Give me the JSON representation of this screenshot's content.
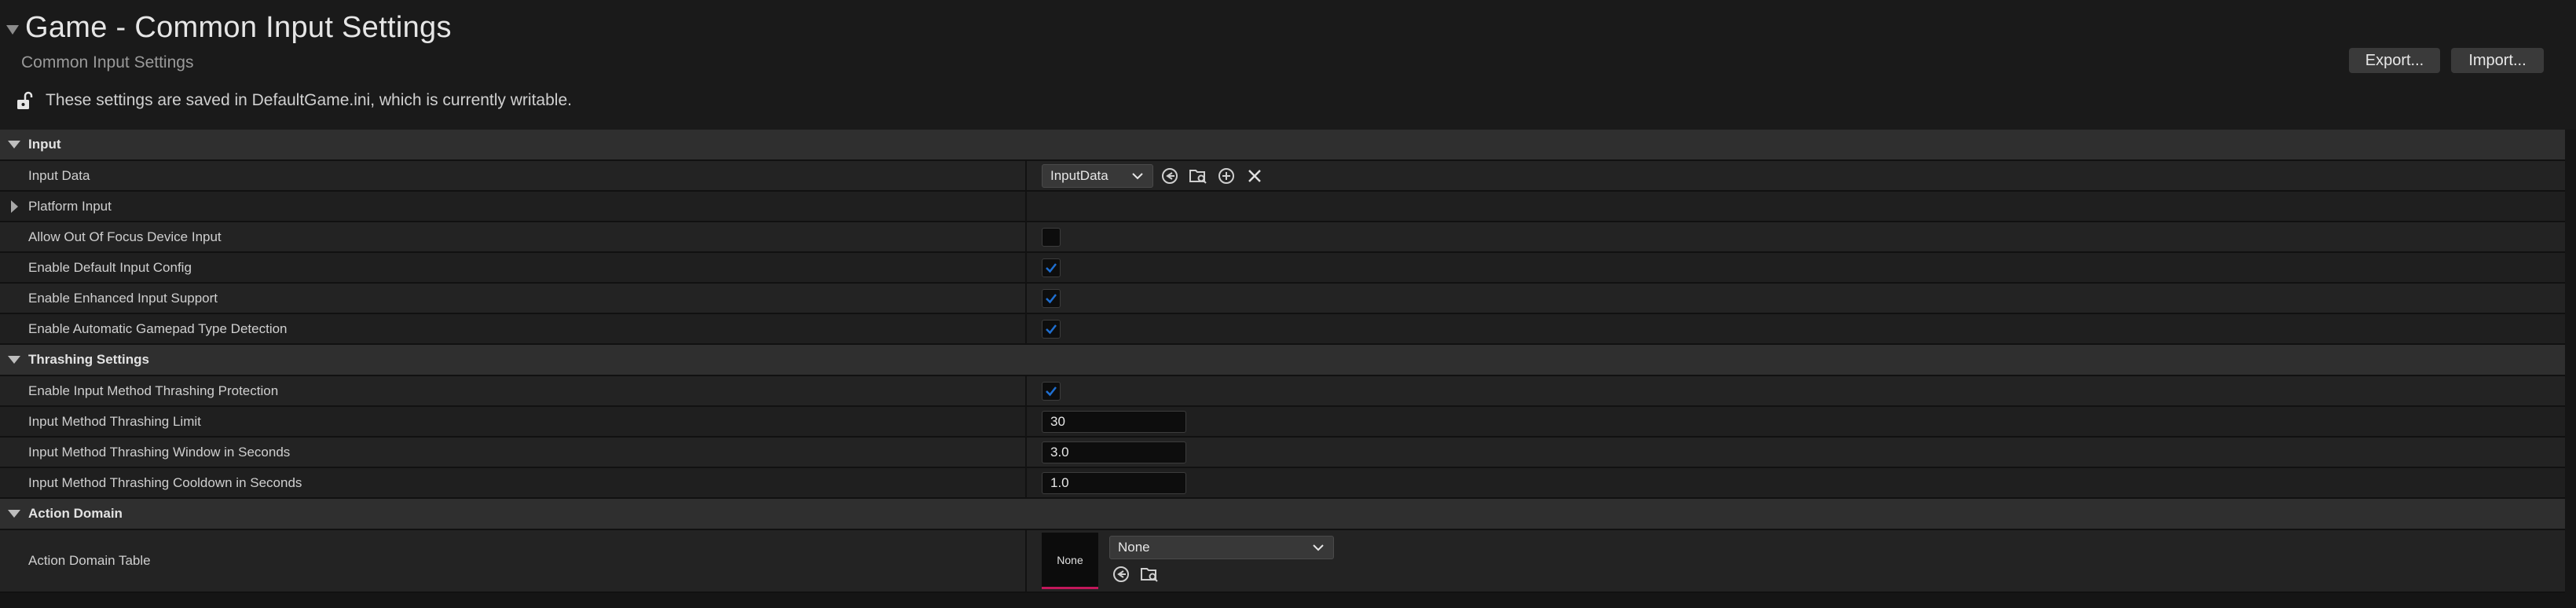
{
  "header": {
    "title": "Game - Common Input Settings",
    "subtitle": "Common Input Settings",
    "notice": "These settings are saved in DefaultGame.ini, which is currently writable.",
    "export_label": "Export...",
    "import_label": "Import..."
  },
  "sections": {
    "input": {
      "label": "Input"
    },
    "thrashing": {
      "label": "Thrashing Settings"
    },
    "action_domain": {
      "label": "Action Domain"
    }
  },
  "properties": {
    "input_data": {
      "label": "Input Data",
      "value": "InputData"
    },
    "platform_input": {
      "label": "Platform Input"
    },
    "allow_out_of_focus": {
      "label": "Allow Out Of Focus Device Input",
      "checked": false
    },
    "enable_default_input_config": {
      "label": "Enable Default Input Config",
      "checked": true
    },
    "enable_enhanced_input": {
      "label": "Enable Enhanced Input Support",
      "checked": true
    },
    "enable_auto_gamepad": {
      "label": "Enable Automatic Gamepad Type Detection",
      "checked": true
    },
    "enable_thrashing_protection": {
      "label": "Enable Input Method Thrashing Protection",
      "checked": true
    },
    "thrashing_limit": {
      "label": "Input Method Thrashing Limit",
      "value": "30"
    },
    "thrashing_window": {
      "label": "Input Method Thrashing Window in Seconds",
      "value": "3.0"
    },
    "thrashing_cooldown": {
      "label": "Input Method Thrashing Cooldown in Seconds",
      "value": "1.0"
    },
    "action_domain_table": {
      "label": "Action Domain Table",
      "thumbnail": "None",
      "value": "None"
    }
  },
  "colors": {
    "accent_check": "#1f6fd1",
    "asset_underline": "#c2185b",
    "section_bg": "#2f2f2f"
  },
  "icons": [
    "chevron-down-icon",
    "lock-open-icon",
    "browse-to-icon",
    "browse-asset-icon",
    "add-icon",
    "clear-icon",
    "check-icon",
    "chevron-right-icon"
  ]
}
